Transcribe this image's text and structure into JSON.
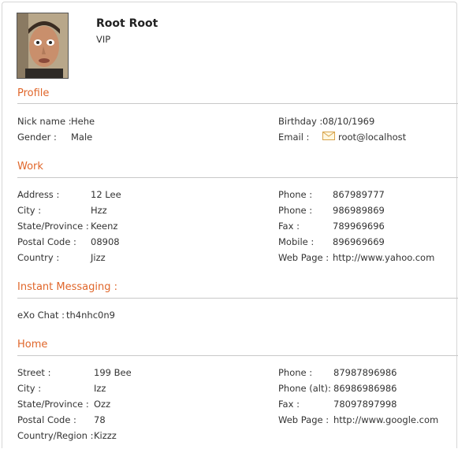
{
  "header": {
    "name": "Root Root",
    "rank": "VIP"
  },
  "profile": {
    "title": "Profile",
    "nick_label": "Nick name :",
    "nick": "Hehe",
    "gender_label": "Gender :",
    "gender": "Male",
    "birthday_label": "Birthday :",
    "birthday": "08/10/1969",
    "email_label": "Email :",
    "email": "root@localhost"
  },
  "work": {
    "title": "Work",
    "address_label": "Address :",
    "address": "12 Lee",
    "city_label": "City :",
    "city": "Hzz",
    "state_label": "State/Province :",
    "state": "Keenz",
    "postal_label": "Postal Code :",
    "postal": "08908",
    "country_label": "Country :",
    "country": "Jizz",
    "phone1_label": "Phone :",
    "phone1": "867989777",
    "phone2_label": "Phone :",
    "phone2": "986989869",
    "fax_label": "Fax :",
    "fax": "789969696",
    "mobile_label": "Mobile :",
    "mobile": "896969669",
    "web_label": "Web Page :",
    "web": "http://www.yahoo.com"
  },
  "im": {
    "title": "Instant Messaging :",
    "label": "eXo Chat :",
    "value": "th4nhc0n9"
  },
  "home": {
    "title": "Home",
    "street_label": "Street :",
    "street": "199 Bee",
    "city_label": "City :",
    "city": "Izz",
    "state_label": "State/Province :",
    "state": "Ozz",
    "postal_label": "Postal Code :",
    "postal": "78",
    "country_label": "Country/Region :",
    "country": "Kizzz",
    "phone_label": "Phone :",
    "phone": "87987896986",
    "phone_alt_label": "Phone (alt):",
    "phone_alt": "86986986986",
    "fax_label": "Fax :",
    "fax": "78097897998",
    "web_label": "Web Page :",
    "web": "http://www.google.com"
  },
  "colors": {
    "section_title": "#e0662a",
    "rule": "#c8c8c8",
    "text": "#333333"
  }
}
